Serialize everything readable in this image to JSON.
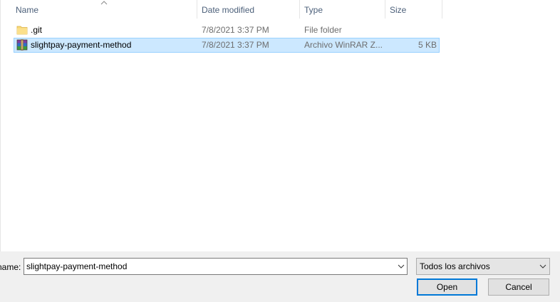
{
  "columns": {
    "name": "Name",
    "date_modified": "Date modified",
    "type": "Type",
    "size": "Size"
  },
  "files": [
    {
      "name": ".git",
      "date": "7/8/2021 3:37 PM",
      "type": "File folder",
      "size": "",
      "icon": "folder-icon",
      "selected": false
    },
    {
      "name": "slightpay-payment-method",
      "date": "7/8/2021 3:37 PM",
      "type": "Archivo WinRAR Z...",
      "size": "5 KB",
      "icon": "winrar-archive-icon",
      "selected": true
    }
  ],
  "filename": {
    "label": "name:",
    "value": "slightpay-payment-method"
  },
  "filetype": {
    "selected": "Todos los archivos"
  },
  "buttons": {
    "open": "Open",
    "cancel": "Cancel"
  },
  "colors": {
    "selection_bg": "#cce8ff",
    "selection_border": "#99d1ff",
    "header_text": "#4c607a",
    "accent": "#0078d7"
  }
}
